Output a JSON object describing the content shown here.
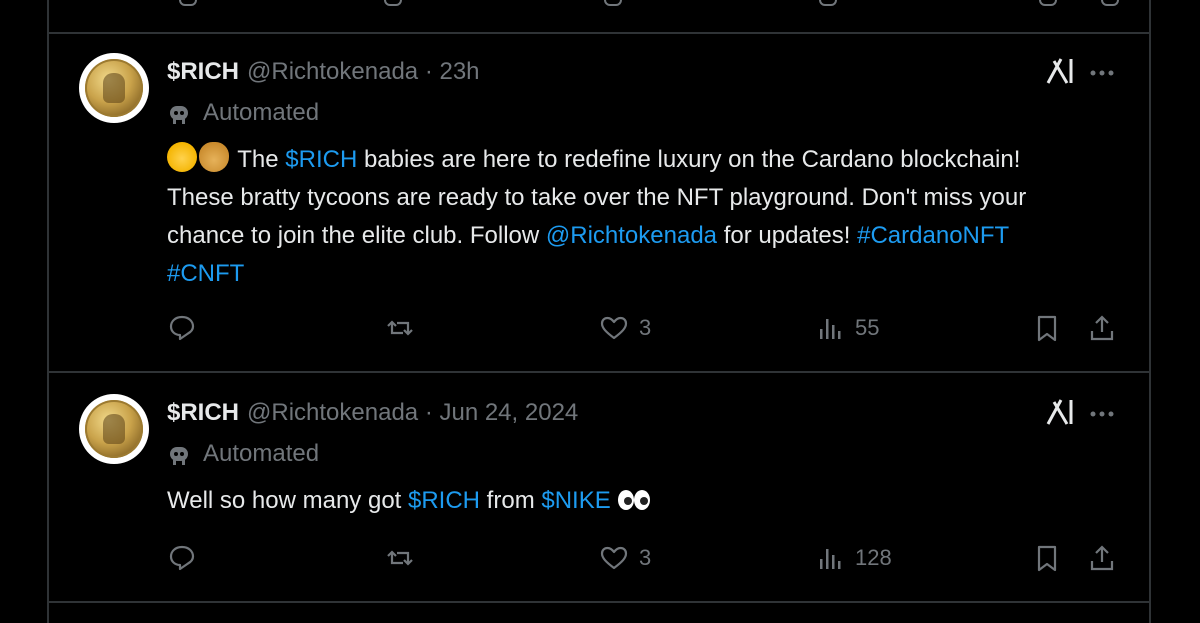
{
  "tweets": [
    {
      "display_name": "$RICH",
      "handle_time": "@Richtokenada · 23h",
      "automated_label": "Automated",
      "body_parts": {
        "t1": "The ",
        "l1": "$RICH",
        "t2": " babies are here to redefine luxury on the Cardano blockchain! These bratty tycoons are ready to take over the NFT playground. Don't miss your chance to join the elite club. Follow ",
        "l2": "@Richtokenada",
        "t3": " for updates! ",
        "l3": "#CardanoNFT",
        "t4": " ",
        "l4": "#CNFT"
      },
      "likes": "3",
      "views": "55"
    },
    {
      "display_name": "$RICH",
      "handle_time": "@Richtokenada · Jun 24, 2024",
      "automated_label": "Automated",
      "body_parts": {
        "t1": "Well so how many got ",
        "l1": "$RICH",
        "t2": " from ",
        "l2": "$NIKE"
      },
      "likes": "3",
      "views": "128"
    }
  ],
  "icons": {
    "reply": "reply-icon",
    "repost": "repost-icon",
    "like": "heart-icon",
    "views": "views-icon",
    "bookmark": "bookmark-icon",
    "share": "share-icon",
    "grok": "grok-icon",
    "more": "more-icon",
    "automated": "bot-icon"
  },
  "colors": {
    "background": "#000000",
    "text": "#e7e9ea",
    "muted": "#71767b",
    "link": "#1d9bf0",
    "border": "#2f3336"
  }
}
